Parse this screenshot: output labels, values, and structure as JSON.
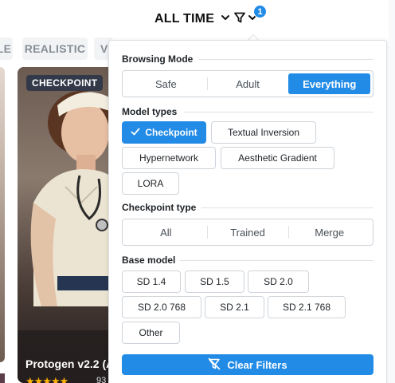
{
  "topbar": {
    "sort_label": "ALL TIME",
    "filter_count": "1"
  },
  "chips": [
    "LE",
    "REALISTIC",
    "V"
  ],
  "card": {
    "badge": "CHECKPOINT",
    "title": "Protogen v2.2 (A",
    "stars": "★★★★★",
    "count": "93"
  },
  "filters": {
    "browsing_mode": {
      "title": "Browsing Mode",
      "options": [
        "Safe",
        "Adult",
        "Everything"
      ],
      "selected": "Everything"
    },
    "model_types": {
      "title": "Model types",
      "options": [
        "Checkpoint",
        "Textual Inversion",
        "Hypernetwork",
        "Aesthetic Gradient",
        "LORA"
      ],
      "selected": "Checkpoint"
    },
    "checkpoint_type": {
      "title": "Checkpoint type",
      "options": [
        "All",
        "Trained",
        "Merge"
      ]
    },
    "base_model": {
      "title": "Base model",
      "options": [
        "SD 1.4",
        "SD 1.5",
        "SD 2.0",
        "SD 2.0 768",
        "SD 2.1",
        "SD 2.1 768",
        "Other"
      ]
    },
    "clear_label": "Clear Filters"
  },
  "colors": {
    "accent": "#228be6",
    "star": "#fab005"
  }
}
